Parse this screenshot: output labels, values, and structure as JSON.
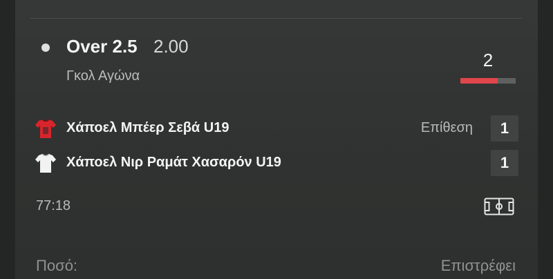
{
  "selection": {
    "name": "Over 2.5",
    "odds": "2.00",
    "market": "Γκολ Αγώνα"
  },
  "live": {
    "total_goals": "2",
    "progress_fraction": 0.68,
    "clock": "77:18"
  },
  "teams": [
    {
      "name": "Χάποελ Μπέερ Σεβά U19",
      "phase": "Επίθεση",
      "score": "1",
      "shirt_color": "#d8242c",
      "shirt_icon": "red-shirt-icon"
    },
    {
      "name": "Χάποελ Νιρ Ραμάτ Χασαρόν U19",
      "phase": "",
      "score": "1",
      "shirt_color": "#f2f2f2",
      "shirt_icon": "white-shirt-icon"
    }
  ],
  "footer": {
    "stake_label": "Ποσό:",
    "returns_label": "Επιστρέφει"
  },
  "colors": {
    "accent": "#e0464c",
    "background": "#2b2d2c"
  }
}
